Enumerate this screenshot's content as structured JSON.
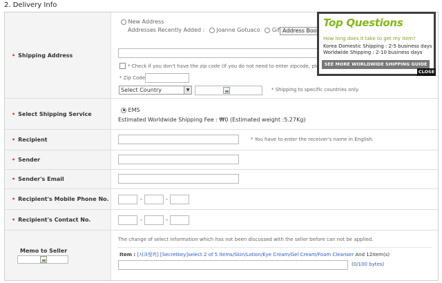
{
  "section_title": "2. Delivery Info",
  "shipping_address": {
    "label": "Shipping Address",
    "new_address": "New Address",
    "recent_label": "Addresses Recently Added :",
    "recent_1": "Joanne Gotuaco",
    "recent_2": "Gift",
    "address_book_btn": "Address Book o",
    "zip_check_text": "* Check if you don't have the zip code (If you do not need to enter zipcode, pleas",
    "zip_label": "* Zip Code",
    "country_select": "Select Country",
    "country_hint": "* Shipping to specific countries only."
  },
  "shipping_service": {
    "label": "Select Shipping Service",
    "option": "EMS",
    "fee_text": "Estimated Worldwide Shipping Fee : ₩0 (Estimated weight :5.27Kg)"
  },
  "recipient": {
    "label": "Recipient",
    "hint": "* You have to enter the receiver's name in English."
  },
  "sender": {
    "label": "Sender"
  },
  "sender_email": {
    "label": "Sender's Email"
  },
  "mobile": {
    "label": "Recipient's Mobile Phone No.",
    "sep": "-"
  },
  "contact": {
    "label": "Recipient's Contact No.",
    "sep": "-"
  },
  "memo": {
    "label": "Memo to Seller",
    "notice": "The change of select information which has not been discussed with the seller before can not be applied.",
    "item_label": "Item :",
    "item_text": "[시크릿키] [Secretkey]select 2 of 5 items/Skin/Lotion/Eye Cream/Gel Cream/Foam Cleanser",
    "item_count": "And 12item(s)",
    "byte_open": "(",
    "byte_count": "0/100 bytes",
    "byte_close": ")"
  },
  "popup": {
    "title": "Top Questions",
    "question": "How long does it take to get my item?",
    "line1": "Korea Domestic Shipping : 2-5 business days",
    "line2": "Worldwide Shipping : 2-10 business days",
    "more_btn": "SEE MORE WORLDWIDE SHIPPING GUIDE",
    "close_btn": "CLOSE"
  },
  "colors": {
    "required_dot": "#e0312b",
    "popup_title": "#84b817",
    "link": "#2a5ab8"
  }
}
